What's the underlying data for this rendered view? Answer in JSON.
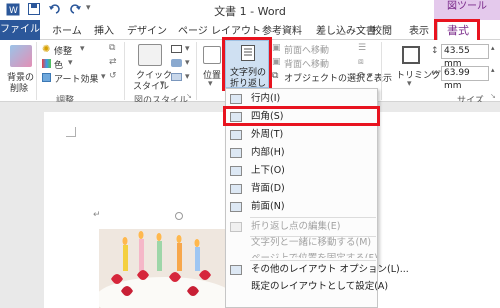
{
  "window": {
    "title": "文書 1 - Word",
    "context_tab_group": "図ツール",
    "qat_icons": [
      "word-icon",
      "save-icon",
      "undo-icon",
      "redo-icon"
    ]
  },
  "tabs": {
    "file": "ファイル",
    "items": [
      "ホーム",
      "挿入",
      "デザイン",
      "ページ レイアウト",
      "参考資料",
      "差し込み文書",
      "校閲",
      "表示"
    ],
    "format": "書式"
  },
  "ribbon": {
    "remove_bg": {
      "line1": "背景の",
      "line2": "削除"
    },
    "adjust": {
      "corrections": "修整",
      "color": "色",
      "art_effects": "アート効果",
      "label": "調整"
    },
    "styles": {
      "quick_line1": "クイック",
      "quick_line2": "スタイル",
      "label": "図のスタイル"
    },
    "arrange": {
      "position": "位置",
      "wrap_line1": "文字列の",
      "wrap_line2": "折り返し",
      "bring_forward": "前面へ移動",
      "send_backward": "背面へ移動",
      "selection_pane": "オブジェクトの選択と表示"
    },
    "size": {
      "crop": "トリミング",
      "height": "43.55 mm",
      "width": "63.99 mm",
      "label": "サイズ"
    }
  },
  "wrap_menu": {
    "items": [
      {
        "label": "行内(I)",
        "enabled": true
      },
      {
        "label": "四角(S)",
        "enabled": true,
        "highlighted": true
      },
      {
        "label": "外周(T)",
        "enabled": true
      },
      {
        "label": "内部(H)",
        "enabled": true
      },
      {
        "label": "上下(O)",
        "enabled": true
      },
      {
        "label": "背面(D)",
        "enabled": true
      },
      {
        "label": "前面(N)",
        "enabled": true
      },
      {
        "label": "折り返し点の編集(E)",
        "enabled": false
      },
      {
        "label": "文字列と一緒に移動する(M)",
        "enabled": false
      },
      {
        "label": "ページ上で位置を固定する(F)",
        "enabled": false
      },
      {
        "label": "その他のレイアウト オプション(L)...",
        "enabled": true
      },
      {
        "label": "既定のレイアウトとして設定(A)",
        "enabled": true
      }
    ]
  },
  "document": {
    "paragraph_mark": "↵"
  },
  "colors": {
    "accent_red": "#e8131f",
    "word_blue": "#2b579a",
    "picture_tools": "#7a2a8a"
  }
}
